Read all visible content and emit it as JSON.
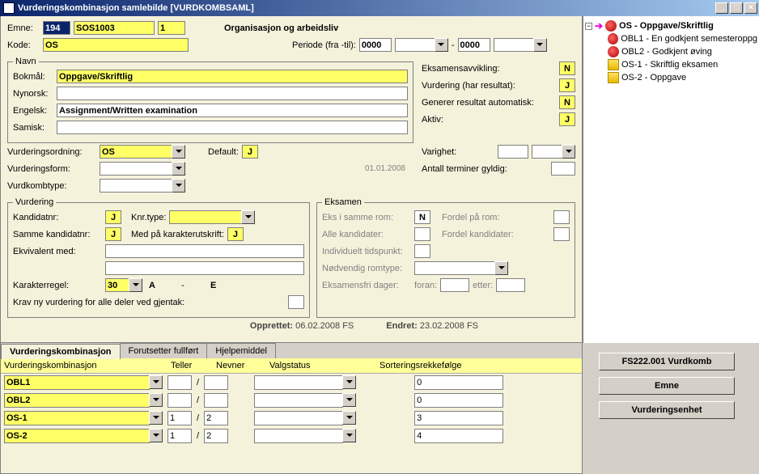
{
  "title": "Vurderingskombinasjon samlebilde   [VURDKOMBSAML]",
  "top": {
    "emne_label": "Emne:",
    "emne_code": "194",
    "emne_id": "SOS1003",
    "emne_ver": "1",
    "org_title": "Organisasjon og arbeidsliv",
    "kode_label": "Kode:",
    "kode": "OS",
    "periode_label": "Periode (fra -til):",
    "periode_from": "0000",
    "periode_to": "0000"
  },
  "navn": {
    "legend": "Navn",
    "bokmal_label": "Bokmål:",
    "bokmal": "Oppgave/Skriftlig",
    "nynorsk_label": "Nynorsk:",
    "nynorsk": "",
    "engelsk_label": "Engelsk:",
    "engelsk": "Assignment/Written examination",
    "samisk_label": "Samisk:",
    "samisk": ""
  },
  "right_flags": {
    "eksavvikling_label": "Eksamensavvikling:",
    "eksavvikling": "N",
    "vurdres_label": "Vurdering (har resultat):",
    "vurdres": "J",
    "genauto_label": "Generer resultat automatisk:",
    "genauto": "N",
    "aktiv_label": "Aktiv:",
    "aktiv": "J"
  },
  "mid": {
    "vurdordning_label": "Vurderingsordning:",
    "vurdordning": "OS",
    "default_label": "Default:",
    "default": "J",
    "varighet_label": "Varighet:",
    "vurdform_label": "Vurderingsform:",
    "termgyldig_label": "Antall terminer gyldig:",
    "vurdkombtype_label": "Vurdkombtype:",
    "date": "01.01.2008"
  },
  "vurdering": {
    "legend": "Vurdering",
    "kandidatnr_label": "Kandidatnr:",
    "kandidatnr": "J",
    "knrtype_label": "Knr.type:",
    "samme_label": "Samme kandidatnr:",
    "samme": "J",
    "medpaa_label": "Med på karakterutskrift:",
    "medpaa": "J",
    "ekv_label": "Ekvivalent med:",
    "karregel_label": "Karakterregel:",
    "karregel": "30",
    "karra": "A",
    "dash": "-",
    "karrb": "E",
    "krav_label": "Krav ny vurdering for alle deler ved gjentak:"
  },
  "eksamen": {
    "legend": "Eksamen",
    "samme_rom_label": "Eks i samme rom:",
    "samme_rom": "N",
    "fordel_rom_label": "Fordel på rom:",
    "allekand_label": "Alle kandidater:",
    "fordelkand_label": "Fordel kandidater:",
    "indtid_label": "Individuelt tidspunkt:",
    "romtype_label": "Nødvendig romtype:",
    "ekfri_label": "Eksamensfri dager:",
    "foran_label": "foran:",
    "etter_label": "etter:"
  },
  "footer": {
    "opprettet_lbl": "Opprettet:",
    "opprettet": "06.02.2008  FS",
    "endret_lbl": "Endret:",
    "endret": "23.02.2008  FS"
  },
  "tabs": {
    "t1": "Vurderingskombinasjon",
    "t2": "Forutsetter fullført",
    "t3": "Hjelpemiddel"
  },
  "gridhdr": {
    "c1": "Vurderingskombinasjon",
    "c2": "Teller",
    "c3": "Nevner",
    "c4": "Valgstatus",
    "c5": "Sorteringsrekkefølge"
  },
  "gridrows": [
    {
      "vk": "OBL1",
      "t": "",
      "n": "",
      "s": "0"
    },
    {
      "vk": "OBL2",
      "t": "",
      "n": "",
      "s": "0"
    },
    {
      "vk": "OS-1",
      "t": "1",
      "n": "2",
      "s": "3"
    },
    {
      "vk": "OS-2",
      "t": "1",
      "n": "2",
      "s": "4"
    }
  ],
  "slash": "/",
  "rbuttons": {
    "b1": "FS222.001 Vurdkomb",
    "b2": "Emne",
    "b3": "Vurderingsenhet"
  },
  "tree": {
    "root": "OS - Oppgave/Skriftlig",
    "kids": [
      "OBL1 - En godkjent semesteroppg",
      "OBL2 - Godkjent øving",
      "OS-1 - Skriftlig eksamen",
      "OS-2 - Oppgave"
    ]
  }
}
